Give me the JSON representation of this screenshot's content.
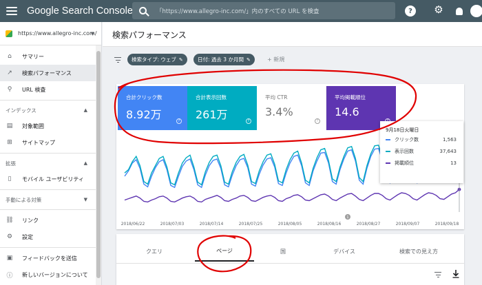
{
  "app": {
    "brand": "Google Search Console",
    "search_placeholder": "「https://www.allegro-inc.com/」内のすべての URL を検査"
  },
  "sidebar": {
    "property": "https://www.allegro-inc.com/",
    "items": [
      {
        "label": "サマリー",
        "icon": "home-icon"
      },
      {
        "label": "検索パフォーマンス",
        "icon": "trending-icon"
      },
      {
        "label": "URL 検査",
        "icon": "search-icon"
      }
    ],
    "section_index": "インデックス",
    "index_items": [
      {
        "label": "対象範囲",
        "icon": "coverage-icon"
      },
      {
        "label": "サイトマップ",
        "icon": "sitemap-icon"
      }
    ],
    "section_ext": "拡張",
    "ext_items": [
      {
        "label": "モバイル ユーザビリティ",
        "icon": "mobile-icon"
      }
    ],
    "section_manual": "手動による対策",
    "bottom_items": [
      {
        "label": "リンク",
        "icon": "link-icon"
      },
      {
        "label": "設定",
        "icon": "settings-icon"
      },
      {
        "label": "フィードバックを送信",
        "icon": "feedback-icon"
      },
      {
        "label": "新しいバージョンについて",
        "icon": "info-icon"
      }
    ]
  },
  "page": {
    "title": "検索パフォーマンス",
    "chip_type": "検索タイプ: ウェブ",
    "chip_date": "日付: 過去 3 か月間",
    "new_label": "新規"
  },
  "metrics": [
    {
      "label": "合計クリック数",
      "value": "8.92万",
      "color": "#4285f4"
    },
    {
      "label": "合計表示回数",
      "value": "261万",
      "color": "#00acc1"
    },
    {
      "label": "平均 CTR",
      "value": "3.4%",
      "color": "#ffffff"
    },
    {
      "label": "平均掲載順位",
      "value": "14.6",
      "color": "#5e35b1"
    }
  ],
  "tooltip": {
    "date": "9月18日火曜日",
    "rows": [
      {
        "label": "クリック数",
        "value": "1,563",
        "color": "#4285f4"
      },
      {
        "label": "表示回数",
        "value": "37,643",
        "color": "#00acc1"
      },
      {
        "label": "掲載順位",
        "value": "13",
        "color": "#5e35b1"
      }
    ]
  },
  "chart_data": {
    "type": "line",
    "x_ticks": [
      "2018/06/22",
      "2018/07/03",
      "2018/07/14",
      "2018/07/25",
      "2018/08/05",
      "2018/08/16",
      "2018/08/27",
      "2018/09/07",
      "2018/09/18"
    ],
    "series": [
      {
        "name": "クリック数",
        "color": "#4285f4",
        "values": [
          0.5,
          0.58,
          0.7,
          0.75,
          0.62,
          0.38,
          0.34,
          0.5,
          0.63,
          0.72,
          0.75,
          0.6,
          0.36,
          0.33,
          0.5,
          0.65,
          0.73,
          0.76,
          0.6,
          0.37,
          0.33,
          0.52,
          0.66,
          0.74,
          0.76,
          0.62,
          0.37,
          0.34,
          0.52,
          0.66,
          0.75,
          0.77,
          0.63,
          0.38,
          0.35,
          0.53,
          0.67,
          0.76,
          0.78,
          0.64,
          0.39,
          0.36,
          0.55,
          0.7,
          0.8,
          0.82,
          0.66,
          0.4,
          0.36,
          0.58,
          0.73,
          0.85,
          0.86,
          0.7,
          0.42,
          0.38,
          0.6,
          0.76,
          0.88,
          0.9,
          0.73,
          0.44,
          0.38,
          0.62,
          0.8,
          0.91,
          0.92,
          0.74,
          0.45,
          0.4,
          0.64,
          0.82,
          0.93,
          0.9,
          0.72,
          0.44,
          0.4,
          0.66,
          0.84,
          0.9,
          0.88,
          0.7,
          0.43,
          0.42,
          0.65,
          0.83,
          0.88,
          0.84
        ]
      },
      {
        "name": "表示回数",
        "color": "#00acc1",
        "values": [
          0.55,
          0.6,
          0.72,
          0.8,
          0.66,
          0.42,
          0.38,
          0.55,
          0.66,
          0.77,
          0.8,
          0.64,
          0.4,
          0.37,
          0.55,
          0.7,
          0.78,
          0.82,
          0.64,
          0.41,
          0.37,
          0.57,
          0.71,
          0.8,
          0.82,
          0.66,
          0.41,
          0.38,
          0.57,
          0.71,
          0.8,
          0.83,
          0.67,
          0.42,
          0.39,
          0.58,
          0.72,
          0.82,
          0.84,
          0.68,
          0.43,
          0.4,
          0.6,
          0.75,
          0.85,
          0.88,
          0.7,
          0.44,
          0.4,
          0.62,
          0.78,
          0.9,
          0.92,
          0.74,
          0.46,
          0.42,
          0.64,
          0.8,
          0.93,
          0.95,
          0.77,
          0.48,
          0.42,
          0.66,
          0.84,
          0.96,
          0.97,
          0.78,
          0.49,
          0.44,
          0.68,
          0.86,
          0.98,
          0.95,
          0.76,
          0.48,
          0.44,
          0.7,
          0.88,
          0.95,
          0.93,
          0.74,
          0.47,
          0.46,
          0.69,
          0.87,
          0.92,
          0.9
        ]
      },
      {
        "name": "掲載順位",
        "color": "#5e35b1",
        "values": [
          0.14,
          0.16,
          0.18,
          0.2,
          0.17,
          0.12,
          0.11,
          0.14,
          0.16,
          0.19,
          0.2,
          0.17,
          0.12,
          0.11,
          0.14,
          0.17,
          0.19,
          0.2,
          0.17,
          0.12,
          0.11,
          0.15,
          0.17,
          0.19,
          0.21,
          0.18,
          0.13,
          0.12,
          0.15,
          0.17,
          0.2,
          0.21,
          0.18,
          0.13,
          0.12,
          0.15,
          0.18,
          0.2,
          0.21,
          0.18,
          0.13,
          0.12,
          0.16,
          0.18,
          0.21,
          0.22,
          0.19,
          0.14,
          0.13,
          0.16,
          0.19,
          0.22,
          0.23,
          0.2,
          0.15,
          0.13,
          0.17,
          0.2,
          0.23,
          0.24,
          0.2,
          0.15,
          0.13,
          0.17,
          0.21,
          0.24,
          0.24,
          0.21,
          0.16,
          0.14,
          0.18,
          0.22,
          0.25,
          0.24,
          0.21,
          0.16,
          0.14,
          0.18,
          0.22,
          0.25,
          0.24,
          0.21,
          0.16,
          0.15,
          0.19,
          0.23,
          0.25,
          0.3
        ]
      }
    ],
    "annotation_marker": "1"
  },
  "tabs": [
    {
      "label": "クエリ"
    },
    {
      "label": "ページ"
    },
    {
      "label": "国"
    },
    {
      "label": "デバイス"
    },
    {
      "label": "検索での見え方"
    }
  ]
}
